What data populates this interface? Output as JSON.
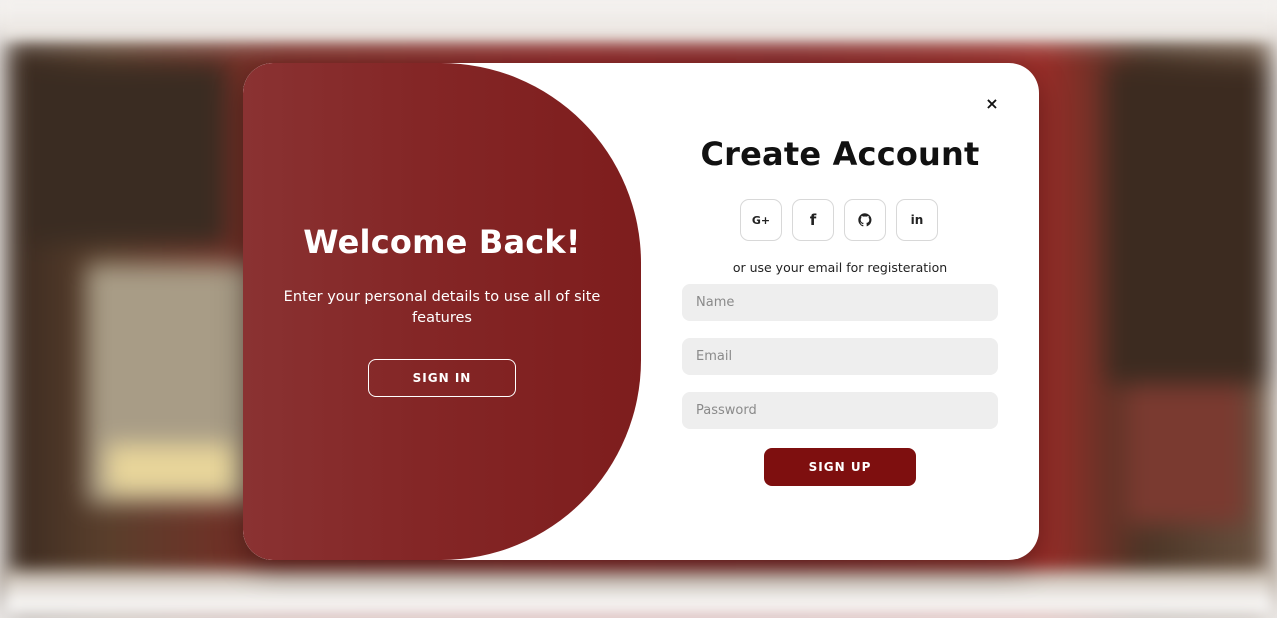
{
  "colors": {
    "brand": "#842626",
    "button_primary": "#7e0f0f",
    "field_bg": "#eeeeee",
    "text_dark": "#111111"
  },
  "welcome_panel": {
    "title": "Welcome Back!",
    "description": "Enter your personal details to use all of site features",
    "signin_label": "SIGN IN"
  },
  "signup_panel": {
    "close_label": "×",
    "title": "Create Account",
    "socials": [
      {
        "label": "G+",
        "icon": "google-plus-icon"
      },
      {
        "label": "f",
        "icon": "facebook-icon"
      },
      {
        "label": "",
        "icon": "github-icon"
      },
      {
        "label": "in",
        "icon": "linkedin-icon"
      }
    ],
    "or_text": "or use your email for registeration",
    "fields": {
      "name_placeholder": "Name",
      "email_placeholder": "Email",
      "password_placeholder": "Password"
    },
    "signup_label": "SIGN UP"
  }
}
